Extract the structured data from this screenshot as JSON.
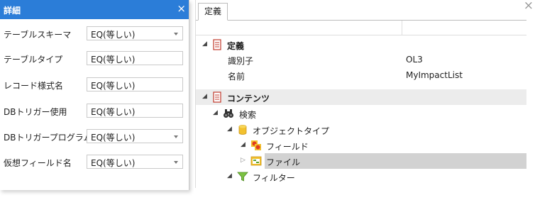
{
  "detail_panel": {
    "title": "詳細",
    "close_icon": "×",
    "fields": [
      {
        "label": "テーブルスキーマ",
        "value": "EQ(等しい)",
        "has_dropdown": true
      },
      {
        "label": "テーブルタイプ",
        "value": "EQ(等しい)",
        "has_dropdown": false
      },
      {
        "label": "レコード様式名",
        "value": "EQ(等しい)",
        "has_dropdown": false
      },
      {
        "label": "DBトリガー使用",
        "value": "EQ(等しい)",
        "has_dropdown": false
      },
      {
        "label": "DBトリガープログラム",
        "value": "EQ(等しい)",
        "has_dropdown": true
      },
      {
        "label": "仮想フィールド名",
        "value": "EQ(等しい)",
        "has_dropdown": true
      }
    ]
  },
  "definition_panel": {
    "tab_label": "定義",
    "close_icon": "×",
    "tree": {
      "definition_section": {
        "label": "定義",
        "properties": [
          {
            "label": "識別子",
            "value": "OL3"
          },
          {
            "label": "名前",
            "value": "MyImpactList"
          }
        ]
      },
      "contents_section": {
        "label": "コンテンツ",
        "search_node": "検索",
        "object_type_node": "オブジェクトタイプ",
        "field_node": "フィールド",
        "file_node": "ファイル",
        "filter_node": "フィルター"
      }
    }
  },
  "colors": {
    "accent": "#2b7dd8",
    "selection": "#d2d2d2",
    "section_bg": "#ececec"
  }
}
